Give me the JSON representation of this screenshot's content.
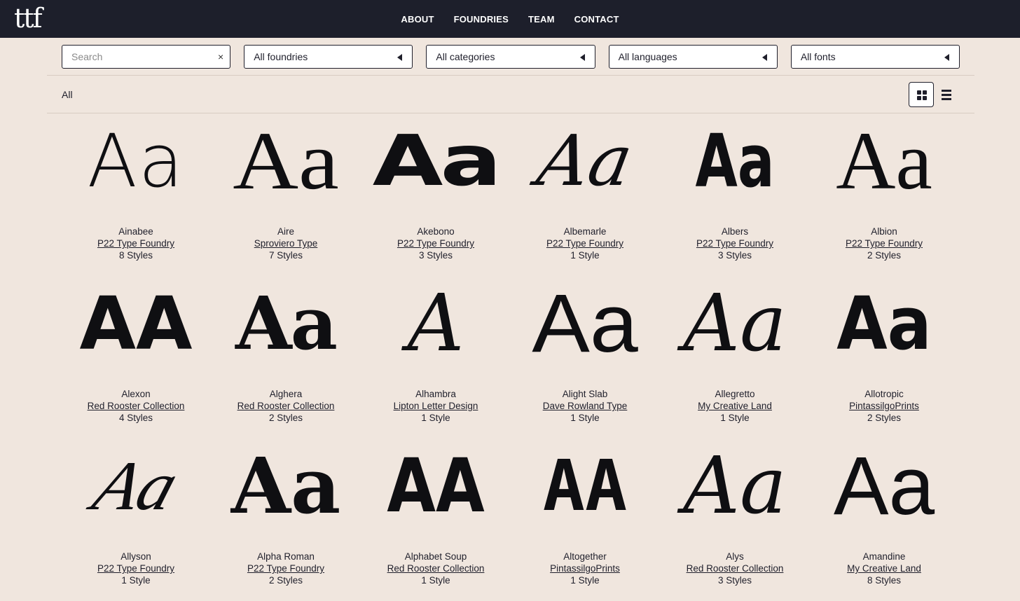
{
  "header": {
    "logo": "ttf",
    "nav": [
      "ABOUT",
      "FOUNDRIES",
      "TEAM",
      "CONTACT"
    ]
  },
  "filters": {
    "search_placeholder": "Search",
    "clear_label": "×",
    "foundries": "All foundries",
    "categories": "All categories",
    "languages": "All languages",
    "fonts": "All fonts"
  },
  "breadcrumb": "All",
  "fonts": [
    {
      "specimen": "Aa",
      "name": "Ainabee",
      "foundry": "P22 Type Foundry",
      "styles": "8 Styles"
    },
    {
      "specimen": "Aa",
      "name": "Aire",
      "foundry": "Sproviero Type",
      "styles": "7 Styles"
    },
    {
      "specimen": "Aa",
      "name": "Akebono",
      "foundry": "P22 Type Foundry",
      "styles": "3 Styles"
    },
    {
      "specimen": "Aa",
      "name": "Albemarle",
      "foundry": "P22 Type Foundry",
      "styles": "1 Style"
    },
    {
      "specimen": "Aa",
      "name": "Albers",
      "foundry": "P22 Type Foundry",
      "styles": "3 Styles"
    },
    {
      "specimen": "Aa",
      "name": "Albion",
      "foundry": "P22 Type Foundry",
      "styles": "2 Styles"
    },
    {
      "specimen": "AA",
      "name": "Alexon",
      "foundry": "Red Rooster Collection",
      "styles": "4 Styles"
    },
    {
      "specimen": "Aa",
      "name": "Alghera",
      "foundry": "Red Rooster Collection",
      "styles": "2 Styles"
    },
    {
      "specimen": "A",
      "name": "Alhambra",
      "foundry": "Lipton Letter Design",
      "styles": "1 Style"
    },
    {
      "specimen": "Aa",
      "name": "Alight Slab",
      "foundry": "Dave Rowland Type",
      "styles": "1 Style"
    },
    {
      "specimen": "Aa",
      "name": "Allegretto",
      "foundry": "My Creative Land",
      "styles": "1 Style"
    },
    {
      "specimen": "Aa",
      "name": "Allotropic",
      "foundry": "PintassilgoPrints",
      "styles": "2 Styles"
    },
    {
      "specimen": "Aa",
      "name": "Allyson",
      "foundry": "P22 Type Foundry",
      "styles": "1 Style"
    },
    {
      "specimen": "Aa",
      "name": "Alpha Roman",
      "foundry": "P22 Type Foundry",
      "styles": "2 Styles"
    },
    {
      "specimen": "AA",
      "name": "Alphabet Soup",
      "foundry": "Red Rooster Collection",
      "styles": "1 Style"
    },
    {
      "specimen": "AA",
      "name": "Altogether",
      "foundry": "PintassilgoPrints",
      "styles": "1 Style"
    },
    {
      "specimen": "Aa",
      "name": "Alys",
      "foundry": "Red Rooster Collection",
      "styles": "3 Styles"
    },
    {
      "specimen": "Aa",
      "name": "Amandine",
      "foundry": "My Creative Land",
      "styles": "8 Styles"
    }
  ]
}
